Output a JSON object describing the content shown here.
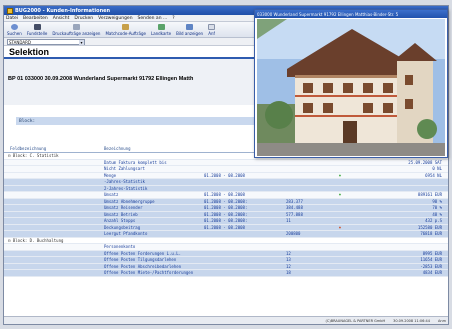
{
  "window": {
    "title": "BUG2000 - Kunden-Informationen"
  },
  "menu": [
    "Datei",
    "Bearbeiten",
    "Ansicht",
    "Drucken",
    "Verzweigungen",
    "Senden an ...",
    "?"
  ],
  "toolbar": [
    {
      "label": "Suchen",
      "icon": "search-icon"
    },
    {
      "label": "Fundstelle",
      "icon": "binoculars-icon"
    },
    {
      "label": "Druckaufträge anzeigen",
      "icon": "printer-icon"
    },
    {
      "label": "Matchcode-Aufträge",
      "icon": "list-icon"
    },
    {
      "label": "Landkarte",
      "icon": "map-icon"
    },
    {
      "label": "Bild anzeigen",
      "icon": "picture-icon"
    },
    {
      "label": "Anf",
      "icon": "document-icon"
    }
  ],
  "combo": {
    "value": "STANDARD"
  },
  "section_title": "Selektion",
  "info_line": "BP  01 033000 30.09.2008 Wunderland Supermarkt 91792 Ellingen Matth",
  "block_label": "Block:",
  "grid": {
    "col_group": "Feldbezeichnung",
    "col_name": "Bezeichnung",
    "rows": [
      {
        "type": "group",
        "grp": "⊟ Block: C. Statistik"
      },
      {
        "type": "light",
        "name": "Datum Faktura komplett bis",
        "per": "",
        "val": "",
        "flag": "",
        "res": "25.09.2008 SAT"
      },
      {
        "type": "light",
        "name": "Nicht Zahlungsart",
        "per": "",
        "val": "",
        "flag": "",
        "res": "0 NL"
      },
      {
        "type": "light",
        "name": "Menge",
        "per": "01.2008 - 08.2008",
        "val": "",
        "flag": "♦",
        "res": "6954 NL"
      },
      {
        "type": "hl",
        "name": "-Jahres-Statistik",
        "per": "",
        "val": "",
        "flag": "",
        "res": ""
      },
      {
        "type": "hl",
        "name": "2-Jahres-Statistik",
        "per": "",
        "val": "",
        "flag": "",
        "res": ""
      },
      {
        "type": "light",
        "name": "Umsatz",
        "per": "01.2008 - 08.2008",
        "val": "",
        "flag": "♦",
        "res": "889161 EUR"
      },
      {
        "type": "hl",
        "name": "Umsatz Abnehmergruppe",
        "per": "01.2008 - 08.2008:",
        "val": "283.377",
        "flag": "",
        "res": "98 %"
      },
      {
        "type": "hl",
        "name": "Umsatz Reisender",
        "per": "01.2008 - 08.2008:",
        "val": "384.488",
        "flag": "",
        "res": "70 %"
      },
      {
        "type": "hl",
        "name": "Umsatz Betrieb",
        "per": "01.2008 - 08.2008:",
        "val": "577.888",
        "flag": "",
        "res": "48 %"
      },
      {
        "type": "hl",
        "name": "Anzahl Stopps",
        "per": "01.2008 - 08.2008:",
        "val": "11",
        "flag": "",
        "res": "432 p.S"
      },
      {
        "type": "hl",
        "name": "Deckungsbeitrag",
        "per": "01.2008 - 08.2008",
        "val": "",
        "flag": "♦",
        "res": "152580 EUR"
      },
      {
        "type": "hl",
        "name": "Leergut Pfandkonto",
        "per": "",
        "val": "200800",
        "flag": "",
        "res": "76818 EUR"
      },
      {
        "type": "group",
        "grp": "⊟ Block: D. Buchhaltung"
      },
      {
        "type": "light",
        "name": "Personenkonto",
        "per": "",
        "val": "",
        "flag": "",
        "res": ""
      },
      {
        "type": "hl",
        "name": "Offene Posten Forderungen L.u.L.",
        "per": "",
        "val": "12",
        "flag": "",
        "res": "8995 EUR"
      },
      {
        "type": "hl",
        "name": "Offene Posten Tilgungsdarlehen",
        "per": "",
        "val": "13",
        "flag": "",
        "res": "11654 EUR"
      },
      {
        "type": "hl",
        "name": "Offene Posten Abschreibedarlehen",
        "per": "",
        "val": "12",
        "flag": "",
        "res": "-2853 EUR"
      },
      {
        "type": "hl",
        "name": "Offene Posten Miete-/Pachtforderungen",
        "per": "",
        "val": "18",
        "flag": "",
        "res": "4834 EUR"
      }
    ]
  },
  "popup": {
    "title": "033000 Wunderland Supermarkt 91792 Ellingen Matthias-Binder-Str. 5"
  },
  "status": {
    "company": "(C)BRAUNAGEL & PARTNER GmbH",
    "datetime": "30.09.2008 11:06:44",
    "mode": "Anm"
  },
  "colors": {
    "accent": "#2e5bb0",
    "highlight_row": "#c7d6ec",
    "value_text": "#1a3f9b"
  }
}
